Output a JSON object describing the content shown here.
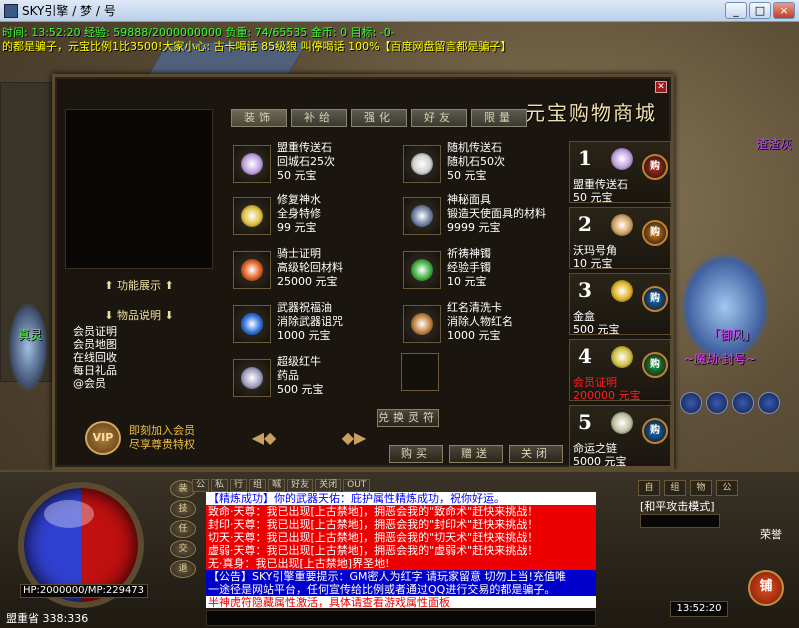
{
  "window": {
    "title": "SKY引擎 / 梦 / 号",
    "minimize": "_",
    "maximize": "□",
    "close": "×"
  },
  "hud": {
    "status_line": "时间: 13:52:20  经验: 59888/2000000000  负重: 74/65535  金币: 0  目标: -0-",
    "broadcast": "的都是骗子，元宝比例1比3500!大家小心: 古卡喝话 85级狼 叫停喝话 100%【百度网盘留言都是骗子】",
    "char_left": "真灵",
    "char_right_top": "渣渣灰",
    "char_right_name": "「御风」",
    "char_right_guild": "~魔劫·封号~"
  },
  "shop": {
    "title": "元宝购物商城",
    "close_icon": "close-icon",
    "tabs": [
      "装饰",
      "补给",
      "强化",
      "好友",
      "限量"
    ],
    "active_tab": 0,
    "side_feature": "⬆ 功能展示 ⬆",
    "side_desc": "⬇ 物品说明 ⬇",
    "side_list": [
      "会员证明",
      "会员地图",
      "在线回收",
      "每日礼品",
      "@会员"
    ],
    "vip_label": "VIP",
    "vip_line1": "即刻加入会员",
    "vip_line2": "尽享尊贵特权",
    "items": [
      {
        "name": "盟重传送石",
        "desc": "回城石25次",
        "price": "50 元宝",
        "icon": "teleport-stone-icon",
        "color": "#c0a0e0"
      },
      {
        "name": "随机传送石",
        "desc": "随机石50次",
        "price": "50 元宝",
        "icon": "random-stone-icon",
        "color": "#d0d0d0"
      },
      {
        "name": "修复神水",
        "desc": "全身特修",
        "price": "99 元宝",
        "icon": "repair-potion-icon",
        "color": "#e0c040"
      },
      {
        "name": "神秘面具",
        "desc": "锻造天使面具的材料",
        "price": "9999 元宝",
        "icon": "mask-icon",
        "color": "#7080a0"
      },
      {
        "name": "骑士证明",
        "desc": "高级轮回材料",
        "price": "25000 元宝",
        "icon": "knight-badge-icon",
        "color": "#e06020"
      },
      {
        "name": "祈祷神镯",
        "desc": "经验手镯",
        "price": "10 元宝",
        "icon": "bracelet-icon",
        "color": "#40b040"
      },
      {
        "name": "武器祝福油",
        "desc": "消除武器诅咒",
        "price": "1000 元宝",
        "icon": "blessing-oil-icon",
        "color": "#3070e0"
      },
      {
        "name": "红名清洗卡",
        "desc": "消除人物红名",
        "price": "1000 元宝",
        "icon": "wash-card-icon",
        "color": "#c08040"
      },
      {
        "name": "超级红牛",
        "desc": "药品",
        "price": "500 元宝",
        "icon": "red-bull-icon",
        "color": "#a0a0c0"
      }
    ],
    "exchange_button": "兑换灵符",
    "prev_icon": "prev-arrow-icon",
    "next_icon": "next-arrow-icon",
    "buttons": [
      "购买",
      "赠送",
      "关闭"
    ],
    "ranking": [
      {
        "rank": "1",
        "name": "盟重传送石",
        "price": "50 元宝",
        "icon": "teleport-stone-icon",
        "color": "#c0a0e0",
        "buy": "购"
      },
      {
        "rank": "2",
        "name": "沃玛号角",
        "price": "10 元宝",
        "icon": "horn-icon",
        "color": "#d0a060",
        "buy": "购"
      },
      {
        "rank": "3",
        "name": "金盒",
        "price": "500 元宝",
        "icon": "gold-box-icon",
        "color": "#e0b020",
        "buy": "购"
      },
      {
        "rank": "4",
        "name": "会员证明",
        "price": "200000 元宝",
        "icon": "vip-card-icon",
        "color": "#d0c040",
        "buy": "购",
        "highlight": true
      },
      {
        "rank": "5",
        "name": "命运之链",
        "price": "5000 元宝",
        "icon": "fate-chain-icon",
        "color": "#c0c0a0",
        "buy": "购"
      }
    ]
  },
  "chat": {
    "tabs": [
      "公",
      "私",
      "行",
      "组",
      "喊",
      "好友",
      "关闭",
      "OUT"
    ],
    "lines": [
      {
        "text": "【精炼成功】你的武器天佑：庇护属性精炼成功，祝你好运。",
        "style": "c-blue"
      },
      {
        "text": "致命·天尊：我已出现[上古禁地]，拥恶会我的\"致命术\"赶快来挑战！",
        "style": "c-red"
      },
      {
        "text": "封印·天尊：我已出现[上古禁地]，拥恶会我的\"封印术\"赶快来挑战！",
        "style": "c-red"
      },
      {
        "text": "切天·天尊：我已出现[上古禁地]，拥恶会我的\"切天术\"赶快来挑战！",
        "style": "c-red"
      },
      {
        "text": "虚弱·天尊：我已出现[上古禁地]，拥恶会我的\"虚弱术\"赶快来挑战！",
        "style": "c-red"
      },
      {
        "text": "无·真身：我已出现[上古禁地]界圣地!",
        "style": "c-red"
      },
      {
        "text": "【公告】SKY引擎重要提示：GM密人为红字 请玩家留意 切勿上当!充值唯",
        "style": "c-white"
      },
      {
        "text": "一途径是网站平台，任何宣传给比例或者通过QQ进行交易的都是骗子。",
        "style": "c-white"
      },
      {
        "text": "半神虎符隐藏属性激活，具体请查看游戏属性面板",
        "style": "c-tail"
      }
    ]
  },
  "status": {
    "hp_mp": "HP:2000000/MP:229473",
    "location": "盟重省 338:336",
    "attack_mode": "[和平攻击模式]",
    "honor": "荣誉",
    "clock": "13:52:20",
    "shop_button": "铺",
    "left_buttons": [
      "装",
      "技",
      "任",
      "交",
      "退"
    ],
    "right_buttons": [
      "自",
      "组",
      "物",
      "公"
    ]
  },
  "colors": {
    "accent_gold": "#f0c040",
    "price_red": "#ff2020",
    "panel_bg": "#1a160f"
  }
}
